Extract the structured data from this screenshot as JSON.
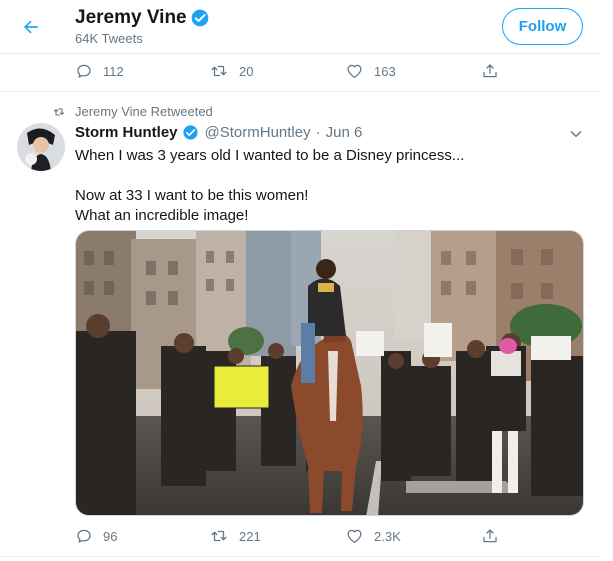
{
  "header": {
    "name": "Jeremy Vine",
    "tweet_count": "64K Tweets",
    "follow_label": "Follow"
  },
  "prev_tweet_actions": {
    "replies": "112",
    "retweets": "20",
    "likes": "163"
  },
  "retweet_context": {
    "text": "Jeremy Vine Retweeted"
  },
  "tweet": {
    "author_name": "Storm Huntley",
    "handle": "@StormHuntley",
    "separator": "·",
    "date": "Jun 6",
    "text_lines": [
      "When I was 3 years old I wanted to be a Disney princess...",
      "Now at 33 I want to be this women!",
      "What an incredible image!"
    ],
    "actions": {
      "replies": "96",
      "retweets": "221",
      "likes": "2.3K"
    }
  },
  "icons": {
    "back": "back-arrow-icon",
    "verified": "verified-badge-icon",
    "reply": "reply-icon",
    "retweet": "retweet-icon",
    "like": "heart-icon",
    "share": "share-icon",
    "menu": "chevron-down-icon"
  },
  "colors": {
    "accent": "#1da1f2",
    "secondary_text": "#657786",
    "divider": "#e6ecf0"
  }
}
